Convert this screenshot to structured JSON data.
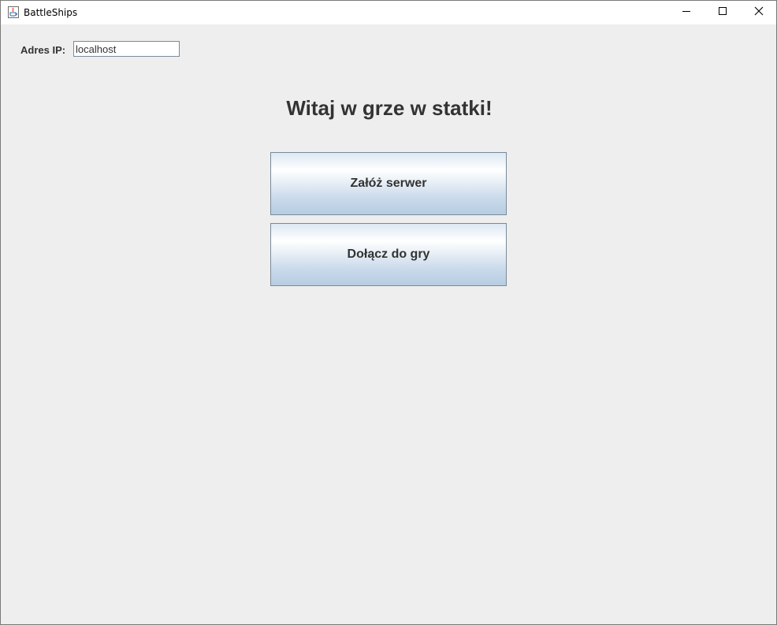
{
  "window": {
    "title": "BattleShips",
    "icons": {
      "app": "java-coffee-icon",
      "minimize": "minimize-icon",
      "maximize": "maximize-icon",
      "close": "close-icon"
    }
  },
  "connection": {
    "ip_label": "Adres IP:",
    "ip_value": "localhost"
  },
  "welcome_text": "Witaj w grze w statki!",
  "buttons": {
    "host_server": "Załóż serwer",
    "join_game": "Dołącz do gry"
  }
}
